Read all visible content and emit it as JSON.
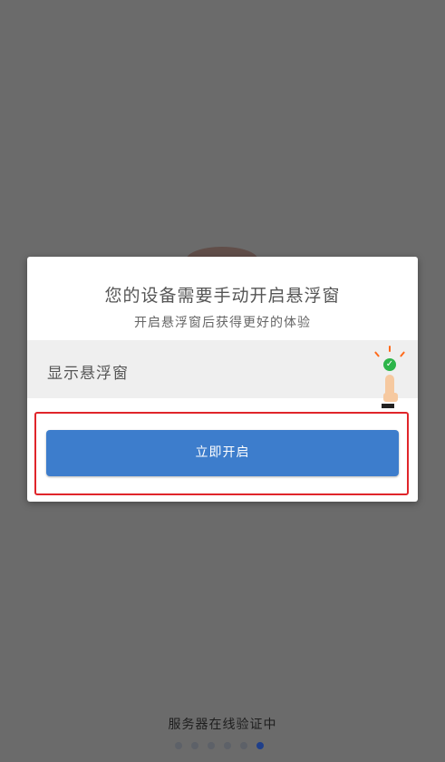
{
  "dialog": {
    "title": "您的设备需要手动开启悬浮窗",
    "subtitle": "开启悬浮窗后获得更好的体验",
    "row_label": "显示悬浮窗",
    "button_label": "立即开启"
  },
  "status": {
    "text": "服务器在线验证中"
  },
  "pagination": {
    "total": 6,
    "active_index": 5
  },
  "colors": {
    "overlay": "#6b6b6b",
    "button": "#3d7dcc",
    "highlight": "#e0252a",
    "check": "#2db54a",
    "active_dot": "#1f3f8a"
  },
  "icons": [
    "check-circle-icon",
    "pointing-finger-icon"
  ]
}
